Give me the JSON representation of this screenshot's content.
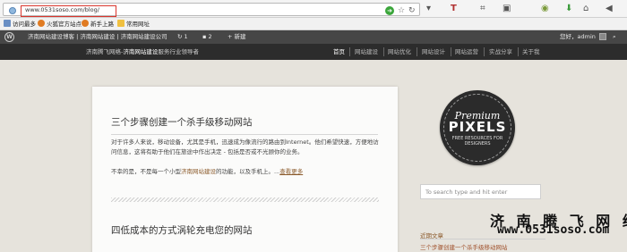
{
  "browser": {
    "url": "www.0531soso.com/blog/",
    "toolbar_icons": [
      "go-icon",
      "star-icon",
      "reload-icon",
      "menu-icon",
      "text-tool-icon",
      "crop-icon",
      "screenshot-icon",
      "addon-icon",
      "download-icon",
      "home-icon",
      "back-icon"
    ]
  },
  "bookmarks": [
    {
      "label": "访问最多",
      "color": "#6a8fc4"
    },
    {
      "label": "火狐官方站点",
      "color": "#e07b22"
    },
    {
      "label": "新手上路",
      "color": "#e07b22"
    },
    {
      "label": "常用网址",
      "color": "#f0c040"
    }
  ],
  "adminbar": {
    "site_links": "济南网站建设博客 | 济南网站建设 | 济南网站建设公司",
    "updates": "1",
    "comments": "2",
    "new": "新建",
    "greeting": "您好，admin"
  },
  "header": {
    "tagline_prefix": "济南腾飞网络-",
    "tagline_highlight": "济南网站建设",
    "tagline_suffix": "服务行业领导者",
    "nav": [
      {
        "label": "首页",
        "active": true
      },
      {
        "label": "网站建设",
        "active": false
      },
      {
        "label": "网站优化",
        "active": false
      },
      {
        "label": "网站设计",
        "active": false
      },
      {
        "label": "网站运营",
        "active": false
      },
      {
        "label": "实战分享",
        "active": false
      },
      {
        "label": "关于我",
        "active": false
      }
    ]
  },
  "posts": [
    {
      "title": "三个步骤创建一个杀手级移动网站",
      "para1": "对于许多人来说，移动设备，尤其是手机，迅速成为像流行的路由到Internet。他们希望快速，方便地访问信息，这将有助于他们在旅途中作出决定 - 包括是否或不光顾你的业务。",
      "para2_prefix": "不幸的是，不是每一个小型",
      "para2_link": "济南网站建设",
      "para2_suffix": "的功能，以及手机上。...",
      "more": "查看更多"
    },
    {
      "title": "四低成本的方式涡轮充电您的网站"
    }
  ],
  "sidebar": {
    "badge_line1": "Premium",
    "badge_line2": "PIXELS",
    "badge_line3": "FREE RESOURCES FOR DESIGNERS",
    "search_placeholder": "To search type and hit enter",
    "watermark_cn": "济 南 腾 飞 网 络",
    "watermark_url": "www.0531soso.com",
    "recent_heading": "近期文章",
    "recent_link": "三个步骤创建一个杀手级移动网站"
  }
}
